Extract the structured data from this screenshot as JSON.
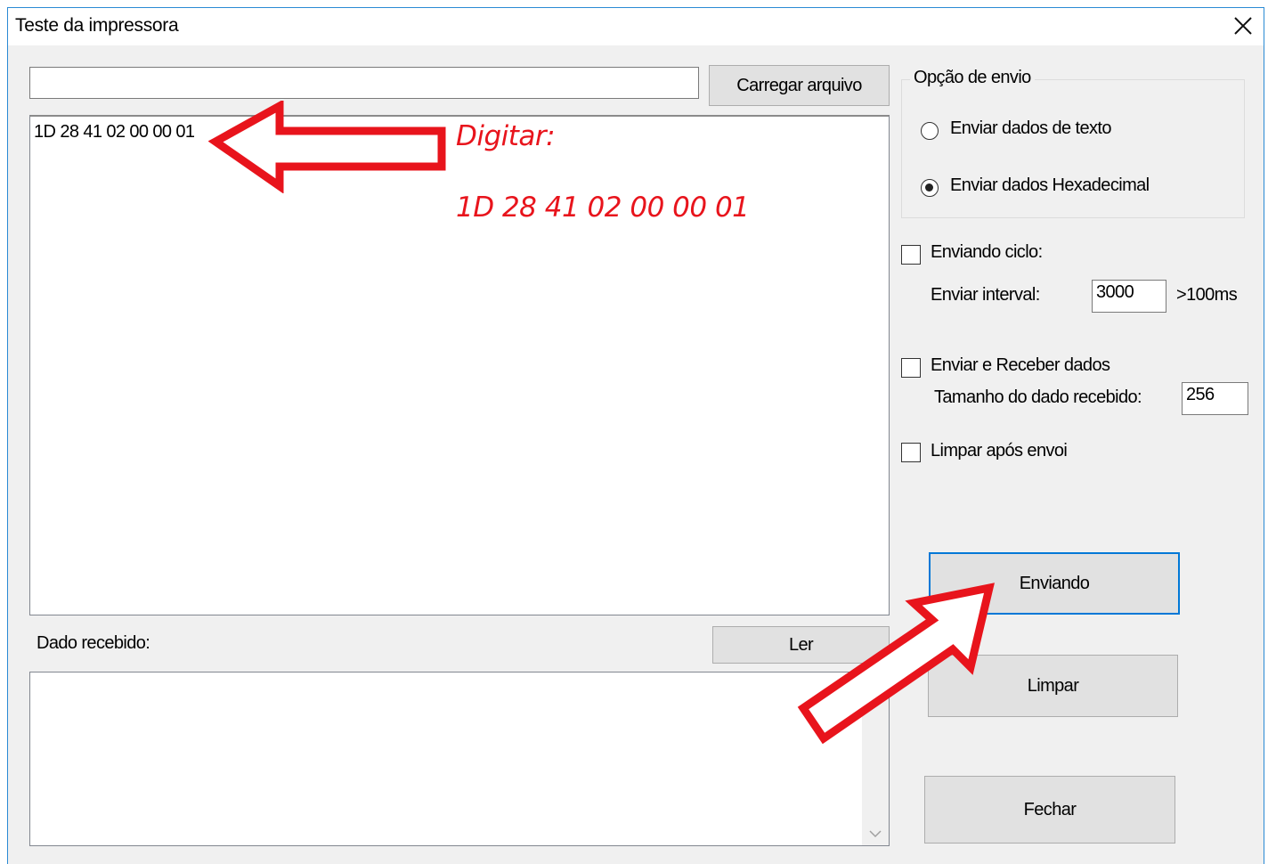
{
  "window": {
    "title": "Teste da impressora"
  },
  "file": {
    "path_value": "",
    "load_button": "Carregar arquivo"
  },
  "editor": {
    "content": "1D 28 41 02 00 00 01"
  },
  "annotation": {
    "label": "Digitar:",
    "value": "1D 28 41 02 00 00 01",
    "color": "#e8141c"
  },
  "received": {
    "label": "Dado recebido:",
    "read_button": "Ler",
    "content": ""
  },
  "send_option": {
    "title": "Opção de envio",
    "options": [
      {
        "label": "Enviar dados de texto",
        "selected": false
      },
      {
        "label": "Enviar dados Hexadecimal",
        "selected": true
      }
    ]
  },
  "cycle": {
    "label": "Enviando ciclo:",
    "checked": false,
    "interval_label": "Enviar interval:",
    "interval_value": "3000",
    "interval_hint": ">100ms"
  },
  "send_receive": {
    "label": "Enviar e Receber dados",
    "checked": false,
    "size_label": "Tamanho do dado recebido:",
    "size_value": "256"
  },
  "clear_after": {
    "label": "Limpar após envoi",
    "checked": false
  },
  "actions": {
    "send": "Enviando",
    "clear": "Limpar",
    "close": "Fechar"
  },
  "colors": {
    "accent": "#0078d7",
    "annotation": "#e8141c"
  }
}
